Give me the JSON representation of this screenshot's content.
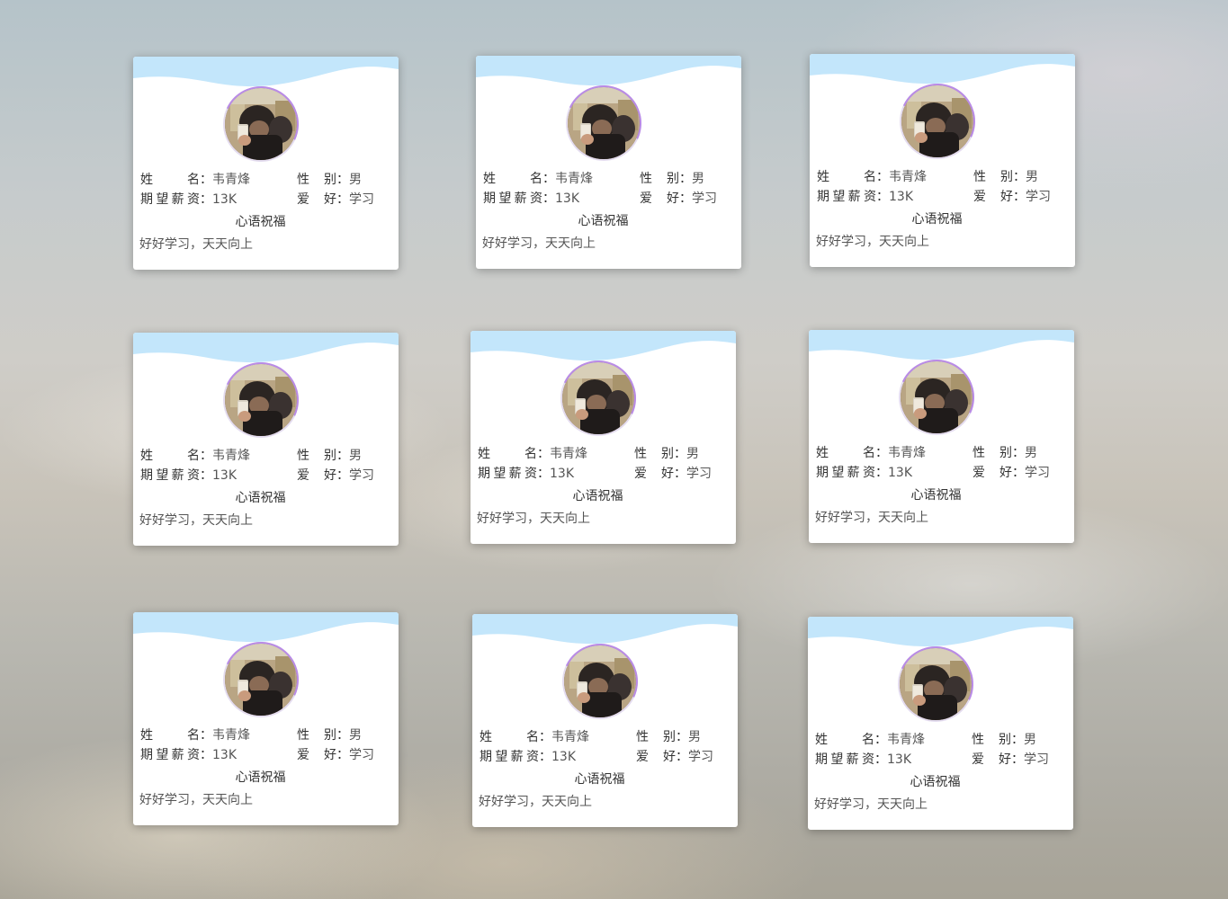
{
  "card": {
    "name_label": "姓名",
    "name_value": "韦青烽",
    "gender_label": "性别",
    "gender_value": "男",
    "salary_label": "期望薪资",
    "salary_value": "13K",
    "hobby_label": "爱好",
    "hobby_value": "学习",
    "colon": "：",
    "wish_title": "心语祝福",
    "wish_text": "好好学习，天天向上"
  },
  "colors": {
    "wave": "#c3e6fb",
    "avatar_ring": "#b98be6",
    "card_bg": "#ffffff"
  },
  "icons": {
    "avatar": "avatar-photo"
  }
}
